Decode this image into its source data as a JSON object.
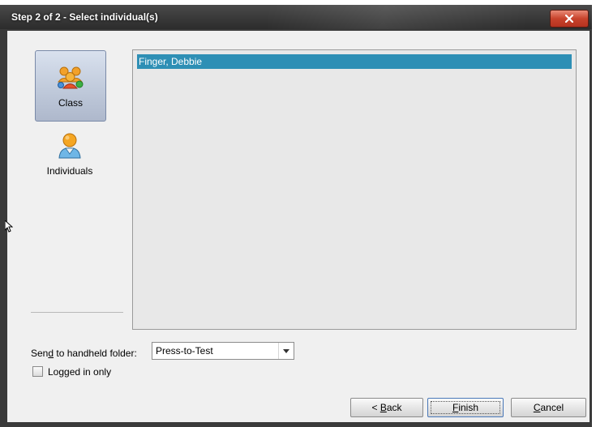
{
  "window": {
    "title": "Step 2 of 2 - Select individual(s)",
    "close_icon": "close-icon"
  },
  "sidebar": {
    "items": [
      {
        "label": "Class",
        "icon": "class-group-icon",
        "selected": true
      },
      {
        "label": "Individuals",
        "icon": "individual-person-icon",
        "selected": false
      }
    ]
  },
  "list": {
    "items": [
      {
        "label": "Finger, Debbie",
        "selected": true
      }
    ]
  },
  "folder": {
    "label": "Send to handheld folder:",
    "value": "Press-to-Test"
  },
  "logged_in_only": {
    "label": "Logged in only",
    "checked": false
  },
  "buttons": {
    "back_label": "< Back",
    "finish_label": "Finish",
    "cancel_label": "Cancel"
  },
  "colors": {
    "selection": "#2e8fb5",
    "close_button": "#c8432c",
    "titlebar": "#2c2c2c"
  }
}
